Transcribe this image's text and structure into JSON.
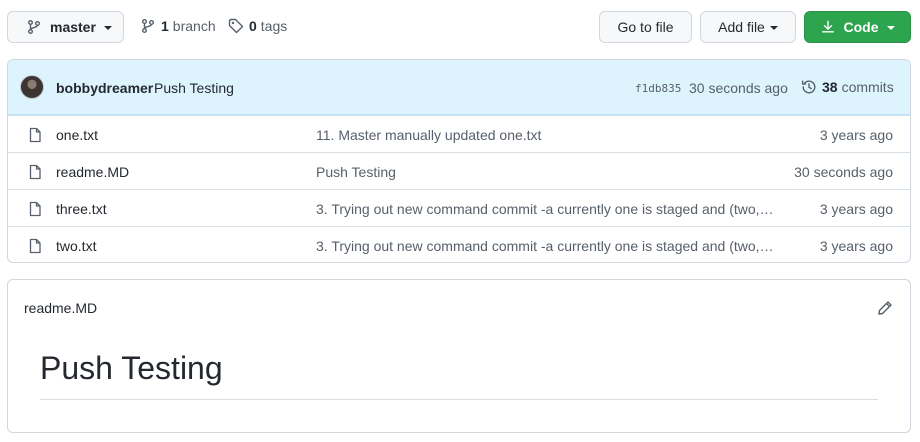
{
  "toolbar": {
    "branch_selector": "master",
    "branch_count": "1",
    "branch_label": "branch",
    "tag_count": "0",
    "tag_label": "tags",
    "go_to_file": "Go to file",
    "add_file": "Add file",
    "code": "Code"
  },
  "latest_commit": {
    "author": "bobbydreamer",
    "message": "Push Testing",
    "sha": "f1db835",
    "time": "30 seconds ago",
    "commit_count": "38",
    "commit_label": "commits"
  },
  "files": [
    {
      "name": "one.txt",
      "message": "11. Master manually updated one.txt",
      "age": "3 years ago"
    },
    {
      "name": "readme.MD",
      "message": "Push Testing",
      "age": "30 seconds ago"
    },
    {
      "name": "three.txt",
      "message": "3. Trying out new command commit -a currently one is staged and (two,…",
      "age": "3 years ago"
    },
    {
      "name": "two.txt",
      "message": "3. Trying out new command commit -a currently one is staged and (two,…",
      "age": "3 years ago"
    }
  ],
  "readme": {
    "filename": "readme.MD",
    "heading": "Push Testing"
  },
  "colors": {
    "code_button": "#2da44e",
    "commit_bar": "#ddf4ff"
  }
}
